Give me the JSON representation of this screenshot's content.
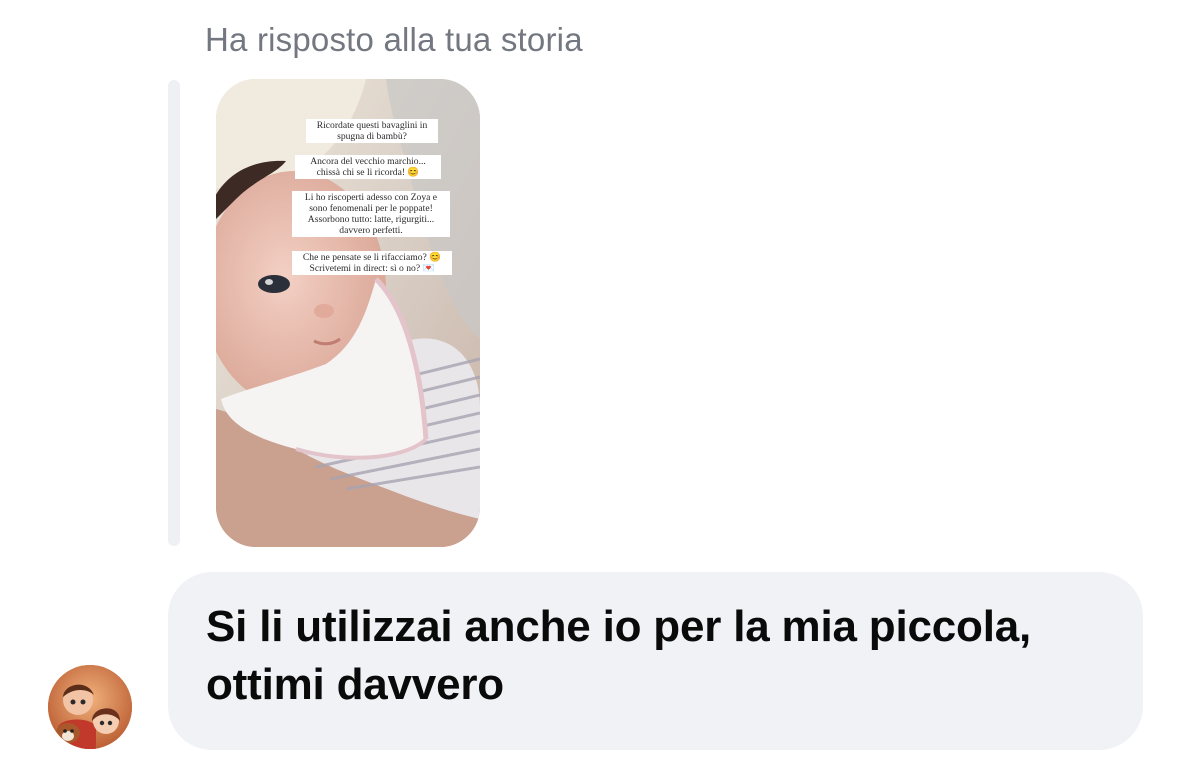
{
  "thread": {
    "reply_label": "Ha risposto alla tua storia",
    "story": {
      "captions": [
        "Ricordate questi bavaglini in\nspugna di bambù?",
        "Ancora del vecchio marchio...\nchissà chi se li ricorda! 😊",
        "Li ho riscoperti adesso con Zoya e\nsono fenomenali per le poppate!\nAssorbono tutto: latte, rigurgiti...\ndavvero perfetti.",
        "Che ne pensate se li rifacciamo? 😊\nScrivetemi in direct: sì o no? 💌"
      ]
    },
    "message": {
      "text": "Si li utilizzai anche io per la mia piccola, ottimi davvero"
    },
    "sender": {
      "avatar_icon": "avatar-family-illustration-icon"
    }
  },
  "colors": {
    "label_gray": "#737780",
    "bubble_bg": "#f0f2f5",
    "quote_bar": "#eef0f3",
    "text": "#0a0a0a"
  }
}
